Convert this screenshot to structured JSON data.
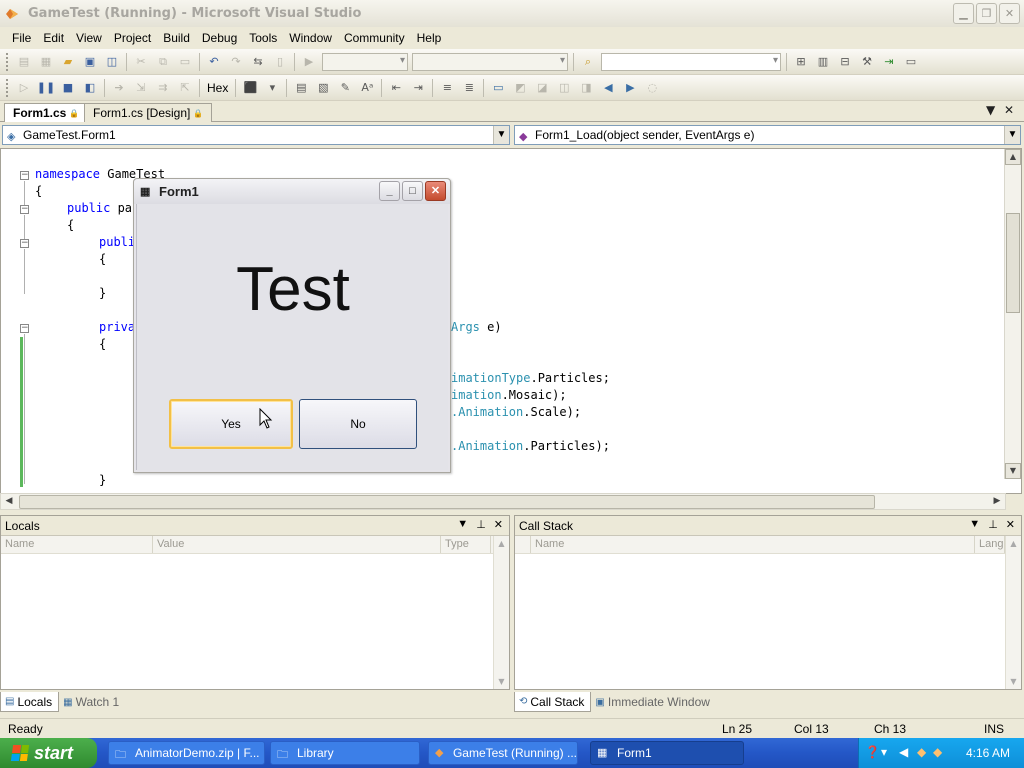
{
  "window": {
    "title": "GameTest (Running) - Microsoft Visual Studio"
  },
  "menu": [
    "File",
    "Edit",
    "View",
    "Project",
    "Build",
    "Debug",
    "Tools",
    "Window",
    "Community",
    "Help"
  ],
  "toolbar2": {
    "hex_label": "Hex"
  },
  "document_tabs": [
    {
      "label": "Form1.cs",
      "active": true
    },
    {
      "label": "Form1.cs [Design]",
      "active": false
    }
  ],
  "navbar": {
    "type_combo": "GameTest.Form1",
    "member_combo": "Form1_Load(object sender, EventArgs e)"
  },
  "code": {
    "line1": {
      "kw": "namespace",
      "rest": " GameTest"
    },
    "line2": "{",
    "line3": {
      "kw": "public",
      "rest": " pa"
    },
    "line4": "{",
    "line5": "publi",
    "line6": "{",
    "line7": "}",
    "line8a": "priva",
    "line8b": {
      "ty": "Args",
      "rest": " e)"
    },
    "line9": "{",
    "line10": {
      "ty": "imationType",
      "rest": ".Particles;"
    },
    "line11": {
      "ty": "imation",
      "rest": ".Mosaic);"
    },
    "line12": {
      "ty": ".Animation",
      "rest": ".Scale);"
    },
    "line13": {
      "ty": ".Animation",
      "rest": ".Particles);"
    },
    "line14": "}"
  },
  "form1": {
    "title": "Form1",
    "big_text": "Test",
    "yes_label": "Yes",
    "no_label": "No"
  },
  "locals": {
    "title": "Locals",
    "columns": [
      "Name",
      "Value",
      "Type"
    ]
  },
  "callstack": {
    "title": "Call Stack",
    "columns": [
      "Name",
      "Lang"
    ]
  },
  "left_tabs": [
    {
      "label": "Locals",
      "active": true
    },
    {
      "label": "Watch 1",
      "active": false
    }
  ],
  "right_tabs": [
    {
      "label": "Call Stack",
      "active": true
    },
    {
      "label": "Immediate Window",
      "active": false
    }
  ],
  "status": {
    "text": "Ready",
    "ln": "Ln 25",
    "col": "Col 13",
    "ch": "Ch 13",
    "mode": "INS"
  },
  "taskbar": {
    "start_label": "start",
    "tasks": [
      {
        "label": "AnimatorDemo.zip | F..."
      },
      {
        "label": "Library"
      },
      {
        "label": "GameTest (Running) ..."
      },
      {
        "label": "Form1",
        "active": true
      }
    ],
    "clock": "4:16 AM"
  },
  "colors": {
    "taskbar": "#2457C7",
    "start": "#3A9B3A",
    "keyword": "#0000FF",
    "type": "#2B91AF"
  }
}
